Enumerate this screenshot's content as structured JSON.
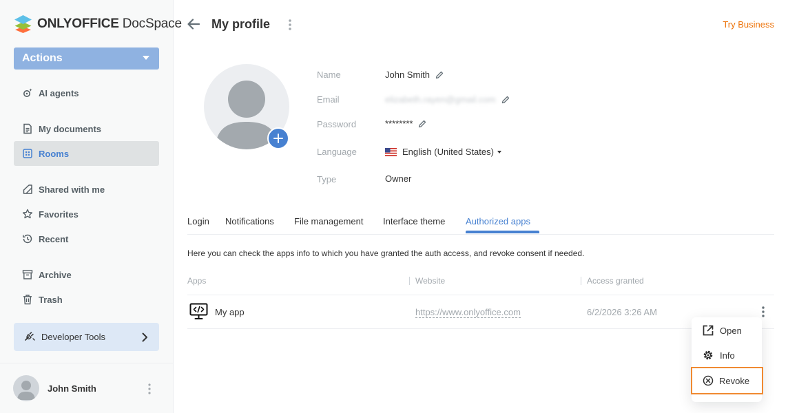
{
  "brand": {
    "name_bold": "ONLYOFFICE",
    "name_regular": " DocSpace"
  },
  "sidebar": {
    "actions_label": "Actions",
    "items": [
      {
        "label": "AI agents",
        "icon": "ai-agents-icon"
      },
      {
        "label": "My documents",
        "icon": "document-icon"
      },
      {
        "label": "Rooms",
        "icon": "rooms-icon",
        "active": true
      },
      {
        "label": "Shared with me",
        "icon": "shared-icon"
      },
      {
        "label": "Favorites",
        "icon": "star-icon"
      },
      {
        "label": "Recent",
        "icon": "history-icon"
      },
      {
        "label": "Archive",
        "icon": "archive-icon"
      },
      {
        "label": "Trash",
        "icon": "trash-icon"
      }
    ],
    "developer_tools_label": "Developer Tools",
    "user_name": "John Smith"
  },
  "header": {
    "title": "My profile",
    "try_business": "Try Business"
  },
  "profile": {
    "name_label": "Name",
    "name_value": "John Smith",
    "email_label": "Email",
    "email_value": "elizabeth.rayen@gmail.com",
    "password_label": "Password",
    "password_value": "********",
    "language_label": "Language",
    "language_value": "English (United States)",
    "type_label": "Type",
    "type_value": "Owner"
  },
  "tabs": [
    {
      "label": "Login"
    },
    {
      "label": "Notifications"
    },
    {
      "label": "File management"
    },
    {
      "label": "Interface theme"
    },
    {
      "label": "Authorized apps",
      "active": true
    }
  ],
  "authorized_apps": {
    "description": "Here you can check the apps info to which you have granted the auth access, and revoke consent if needed.",
    "columns": [
      "Apps",
      "Website",
      "Access granted"
    ],
    "rows": [
      {
        "name": "My app",
        "website": "https://www.onlyoffice.com",
        "access_granted": "6/2/2026 3:26 AM"
      }
    ]
  },
  "context_menu": {
    "items": [
      {
        "label": "Open",
        "icon": "external-link-icon"
      },
      {
        "label": "Info",
        "icon": "gear-icon"
      },
      {
        "label": "Revoke",
        "icon": "revoke-circle-x-icon",
        "highlighted": true
      }
    ]
  },
  "colors": {
    "accent": "#4781d1",
    "actions_button": "#8fb2e1",
    "try_business": "#ed7309",
    "highlight_outline": "#f08a32"
  }
}
